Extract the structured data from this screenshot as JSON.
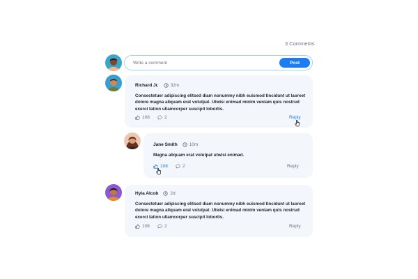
{
  "header": {
    "comments_count": "3 Comments"
  },
  "composer": {
    "placeholder": "Write a comment",
    "post_label": "Post"
  },
  "comments": [
    {
      "author": "Richard Jr.",
      "time": "32m",
      "body": "Consectetuer adipiscing elitsed diam nonummy nibh euismod tincidunt ut laoreet dolore magna aliquam erat volutpat. Utwisi enimad minim veniam quis nostrud exerci tation ullamcorper suscipit lobortis.",
      "likes": "108",
      "replies": "2",
      "reply_label": "Reply"
    },
    {
      "author": "Jane Smith",
      "time": "10m",
      "body": "Magna aliquam erat volutpat utwisi enimad.",
      "likes": "108",
      "replies": "2",
      "reply_label": "Reply"
    },
    {
      "author": "Hyla Alcob",
      "time": "2d",
      "body": "Consectetuer adipiscing elitsed diam nonummy nibh euismod tincidunt ut laoreet dolore magna aliquam erat volutpat. Utwisi enimad minim veniam quis nostrud exerci tation ullamcorper suscipit lobortis.",
      "likes": "108",
      "replies": "2",
      "reply_label": "Reply"
    }
  ],
  "icons": {
    "like": "thumbs-up-icon",
    "comment": "speech-bubble-icon",
    "time": "clock-icon",
    "cursor": "hand-pointer-icon"
  },
  "colors": {
    "accent": "#1b7cf5",
    "card_background": "#f3f6fb",
    "input_border": "#9fd3f7",
    "muted_text": "#6b7280"
  }
}
